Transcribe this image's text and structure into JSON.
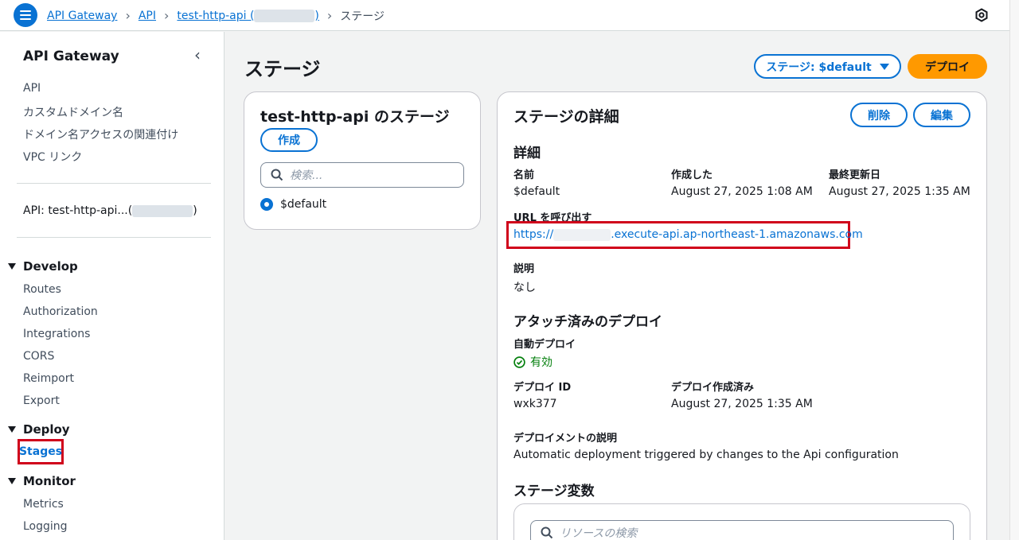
{
  "breadcrumb": {
    "items": [
      "API Gateway",
      "API",
      "test-http-api (",
      ")"
    ],
    "current": "ステージ"
  },
  "sidebar": {
    "title": "API Gateway",
    "top_links": [
      "API",
      "カスタムドメイン名",
      "ドメイン名アクセスの関連付け",
      "VPC リンク"
    ],
    "api_label": "API: test-http-api...(",
    "api_label_end": ")",
    "sections": {
      "develop": {
        "title": "Develop",
        "items": [
          "Routes",
          "Authorization",
          "Integrations",
          "CORS",
          "Reimport",
          "Export"
        ]
      },
      "deploy": {
        "title": "Deploy",
        "items": [
          "Stages"
        ]
      },
      "monitor": {
        "title": "Monitor",
        "items": [
          "Metrics",
          "Logging"
        ]
      }
    }
  },
  "header": {
    "title": "ステージ",
    "stage_dropdown": "ステージ: $default",
    "deploy_button": "デプロイ"
  },
  "stage_list": {
    "title": "test-http-api のステージ",
    "create_button": "作成",
    "search_placeholder": "検索...",
    "stages": [
      "$default"
    ]
  },
  "stage_details": {
    "title": "ステージの詳細",
    "delete_button": "削除",
    "edit_button": "編集",
    "details_heading": "詳細",
    "name_label": "名前",
    "name_value": "$default",
    "created_label": "作成した",
    "created_value": "August 27, 2025 1:08 AM",
    "updated_label": "最終更新日",
    "updated_value": "August 27, 2025 1:35 AM",
    "invoke_url_label": "URL を呼び出す",
    "invoke_url_prefix": "https://",
    "invoke_url_suffix": ".execute-api.ap-northeast-1.amazonaws.com",
    "description_label": "説明",
    "description_value": "なし",
    "attached_heading": "アタッチ済みのデプロイ",
    "auto_deploy_label": "自動デプロイ",
    "auto_deploy_value": "有効",
    "deploy_id_label": "デプロイ ID",
    "deploy_id_value": "wxk377",
    "deploy_created_label": "デプロイ作成済み",
    "deploy_created_value": "August 27, 2025 1:35 AM",
    "deployment_desc_label": "デプロイメントの説明",
    "deployment_desc_value": "Automatic deployment triggered by changes to the Api configuration",
    "stage_vars_heading": "ステージ変数",
    "resource_search_placeholder": "リソースの検索"
  },
  "colors": {
    "accent": "#0972d3",
    "deploy_button": "#ff9900",
    "highlight_box": "#d0021b",
    "success": "#037f0c"
  }
}
